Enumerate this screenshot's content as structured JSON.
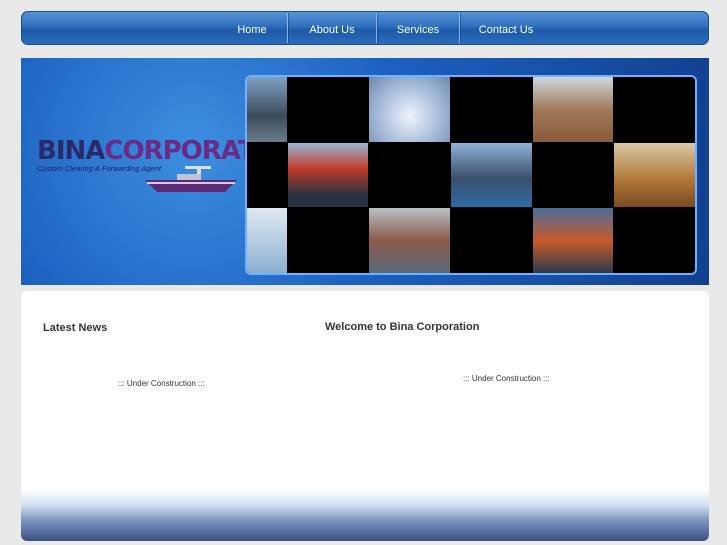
{
  "nav": {
    "items": [
      {
        "label": "Home"
      },
      {
        "label": "About Us"
      },
      {
        "label": "Services"
      },
      {
        "label": "Contact Us"
      }
    ]
  },
  "banner": {
    "logo_part1": "BINA",
    "logo_part2": "CORPORATION",
    "tagline": "Custom Clearing & Forwarding Agent"
  },
  "left_column": {
    "title": "Latest News",
    "status": "::: Under Construction :::"
  },
  "right_column": {
    "title": "Welcome to Bina Corporation",
    "status": "::: Under Construction :::"
  },
  "colors": {
    "nav_blue": "#2f6fbe",
    "banner_blue": "#1c60c0",
    "logo_navy": "#2a2a6a",
    "logo_purple": "#6b2a86"
  }
}
